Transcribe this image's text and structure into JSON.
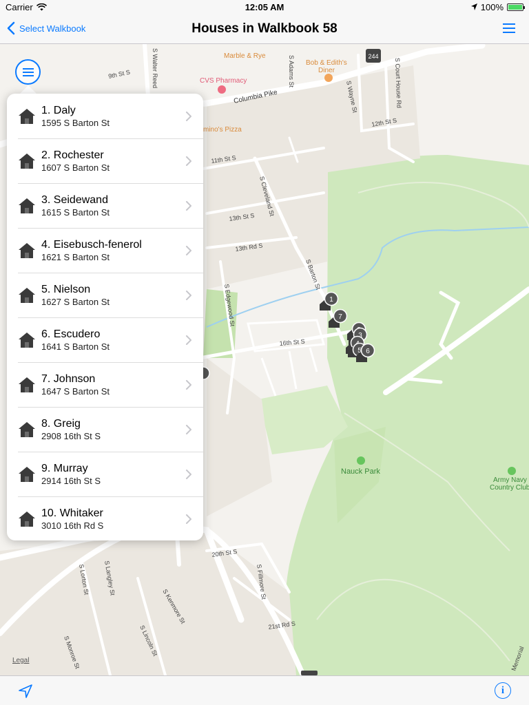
{
  "status_bar": {
    "carrier": "Carrier",
    "time": "12:05 AM",
    "battery": "100%"
  },
  "nav": {
    "back_label": "Select Walkbook",
    "title": "Houses in Walkbook 58"
  },
  "map": {
    "legal": "Legal",
    "labels": {
      "marble_rye": "Marble & Rye",
      "bob_ediths": "Bob & Edith's",
      "diner": "Diner",
      "cvs": "CVS Pharmacy",
      "dominos": "mino's Pizza",
      "columbia_pike": "Columbia Pike",
      "route": "244",
      "nauck_park": "Nauck Park",
      "army_navy_1": "Army Navy",
      "army_navy_2": "Country Club",
      "s_walter_reed": "S Walter Reed",
      "s_adams": "S Adams St",
      "s_wayne": "S Wayne St",
      "s_court_house": "S Court House Rd",
      "ninth": "9th St S",
      "eleventh": "11th St S",
      "twelfth": "12th St S",
      "thirteenth": "13th St S",
      "thirteenth_rd": "13th Rd S",
      "s_cleveland": "S Cleveland St",
      "s_barton": "S Barton St",
      "s_edgewood": "S Edgewood St",
      "sixteenth": "16th St S",
      "twentieth": "20th St S",
      "twentyfirst": "21st Rd S",
      "s_fillmore": "S Fillmore St",
      "s_lorton": "S Lorton St",
      "s_langley": "S Langley St",
      "s_kenmore": "S Kenmore St",
      "s_lincoln": "S Lincoln St",
      "s_monroe": "S Monroe St",
      "memorial": "Memorial"
    },
    "pins": [
      "1",
      "7",
      "2",
      "3",
      "4",
      "5",
      "6"
    ],
    "colors": {
      "park": "#cfe8bd",
      "road": "#ffffff",
      "water": "#9ed0f0",
      "land": "#f4f2ee",
      "block": "#ebe7e0"
    }
  },
  "houses": [
    {
      "title": "1. Daly",
      "address": "1595 S Barton St"
    },
    {
      "title": "2. Rochester",
      "address": "1607 S Barton St"
    },
    {
      "title": "3. Seidewand",
      "address": "1615 S Barton St"
    },
    {
      "title": "4. Eisebusch-fenerol",
      "address": "1621 S Barton St"
    },
    {
      "title": "5. Nielson",
      "address": "1627 S Barton St"
    },
    {
      "title": "6. Escudero",
      "address": "1641 S Barton St"
    },
    {
      "title": "7. Johnson",
      "address": "1647 S Barton St"
    },
    {
      "title": "8. Greig",
      "address": "2908 16th St S"
    },
    {
      "title": "9. Murray",
      "address": "2914 16th St S"
    },
    {
      "title": "10. Whitaker",
      "address": "3010 16th Rd S"
    }
  ],
  "icons": {
    "back": "chevron-left-icon",
    "menu": "menu-icon",
    "house": "house-icon",
    "row_chevron": "chevron-right-icon",
    "location": "location-arrow-icon",
    "info": "info-icon"
  },
  "toolbar": {
    "info_glyph": "i"
  },
  "accent": "#0a7aff"
}
